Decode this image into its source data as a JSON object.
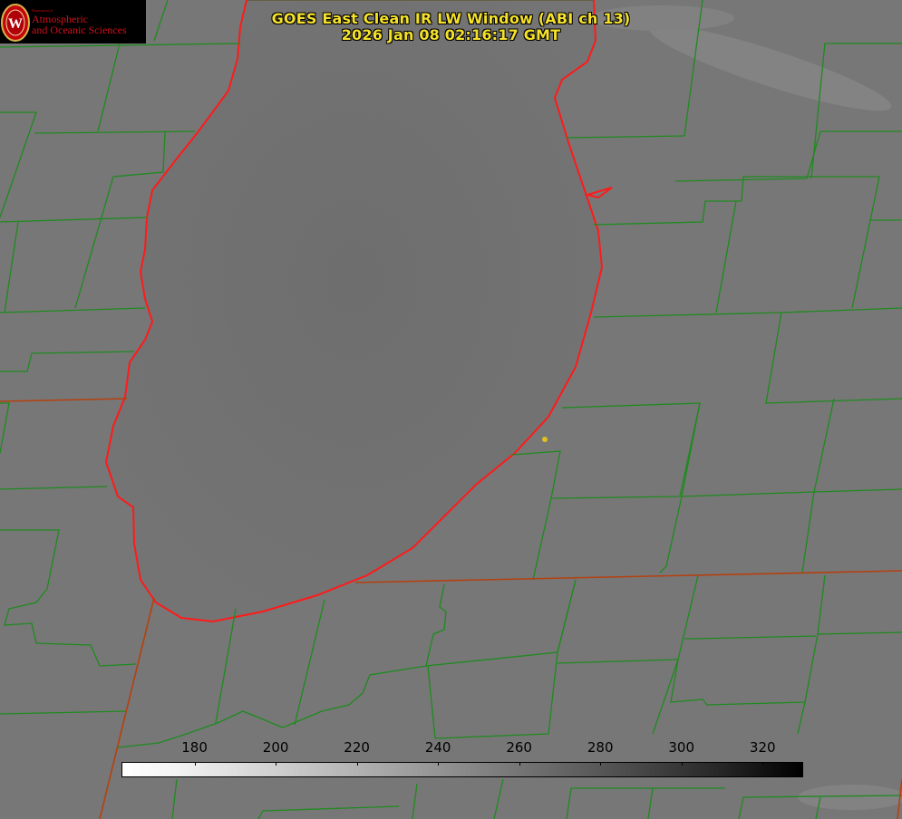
{
  "title": {
    "line1": "GOES East Clean IR LW Window (ABI ch 13)",
    "line2": "2026 Jan 08 02:16:17 GMT"
  },
  "logo": {
    "dept": "Department of",
    "line1": "Atmospheric",
    "line2": "and Oceanic Sciences",
    "emblem_letter": "W"
  },
  "colorbar": {
    "ticks": [
      "180",
      "200",
      "220",
      "240",
      "260",
      "280",
      "300",
      "320"
    ],
    "range": [
      162,
      330
    ]
  },
  "colors": {
    "title": "#f5e12a",
    "county_lines": "#1f8a1f",
    "state_lines": "#b5400f",
    "lake_outline": "#ff1a1a",
    "marker": "#e0c020"
  }
}
